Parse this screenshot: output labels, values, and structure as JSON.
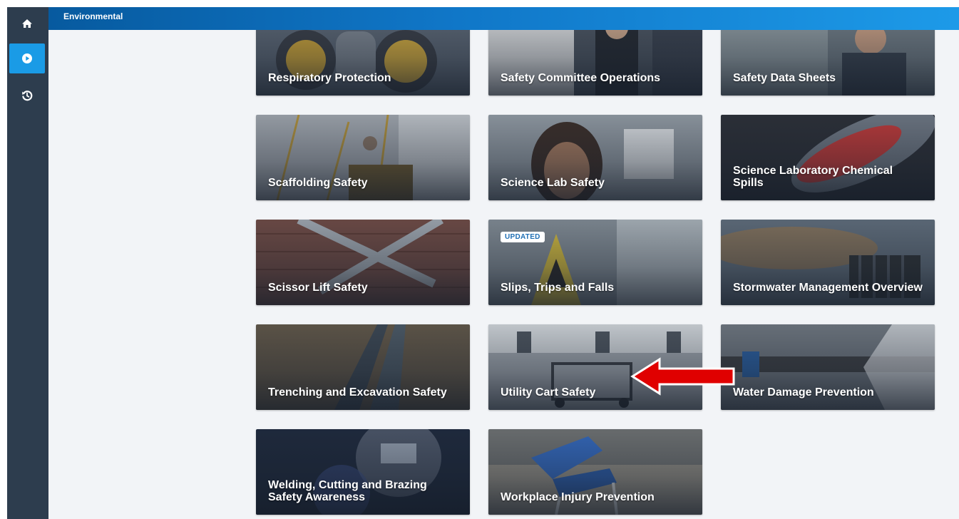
{
  "header": {
    "title": "Environmental"
  },
  "sidebar": {
    "items": [
      {
        "icon": "home-icon",
        "active": false
      },
      {
        "icon": "play-circle-icon",
        "active": true
      },
      {
        "icon": "history-icon",
        "active": false
      }
    ]
  },
  "colors": {
    "sidebar": "#2d3d4e",
    "accent": "#1a9be6",
    "header_start": "#075a9f",
    "header_end": "#1d9ae8",
    "background": "#f2f4f7",
    "arrow": "#e00000"
  },
  "cards": [
    {
      "title": "Respiratory Protection",
      "badge": ""
    },
    {
      "title": "Safety Committee Operations",
      "badge": ""
    },
    {
      "title": "Safety Data Sheets",
      "badge": ""
    },
    {
      "title": "Scaffolding Safety",
      "badge": ""
    },
    {
      "title": "Science Lab Safety",
      "badge": ""
    },
    {
      "title": "Science Laboratory Chemical Spills",
      "badge": ""
    },
    {
      "title": "Scissor Lift Safety",
      "badge": ""
    },
    {
      "title": "Slips, Trips and Falls",
      "badge": "UPDATED"
    },
    {
      "title": "Stormwater Management Overview",
      "badge": ""
    },
    {
      "title": "Trenching and Excavation Safety",
      "badge": ""
    },
    {
      "title": "Utility Cart Safety",
      "badge": ""
    },
    {
      "title": "Water Damage Prevention",
      "badge": ""
    },
    {
      "title": "Welding, Cutting and Brazing Safety Awareness",
      "badge": ""
    },
    {
      "title": "Workplace Injury Prevention",
      "badge": ""
    }
  ]
}
